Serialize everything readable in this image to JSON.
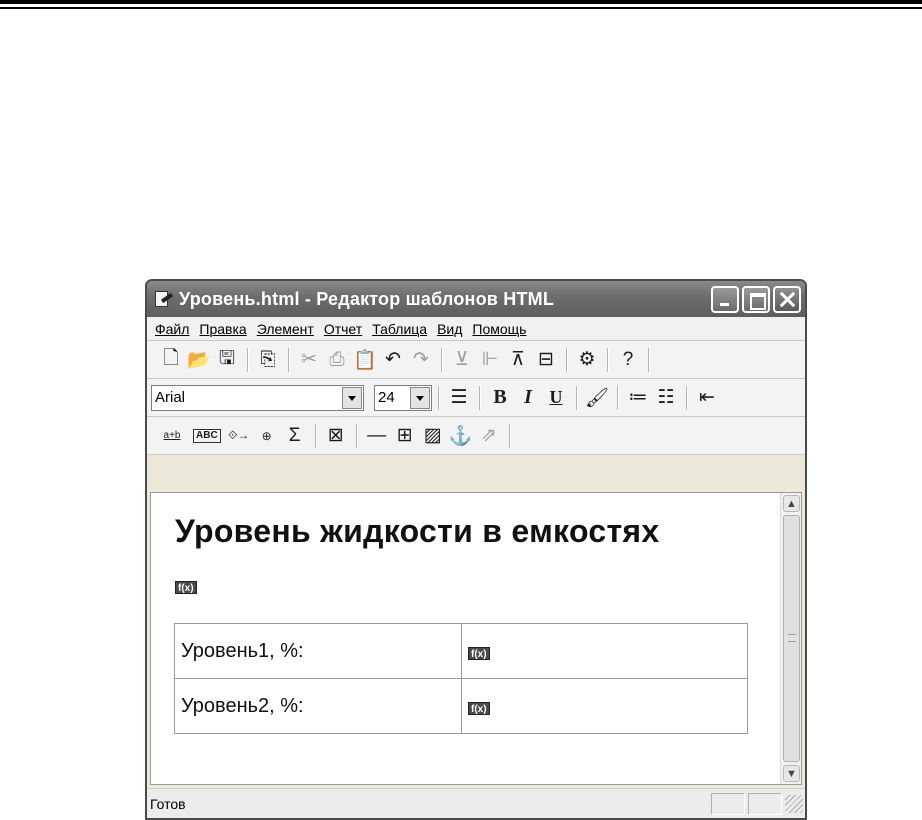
{
  "window": {
    "title": "Уровень.html - Редактор шаблонов HTML"
  },
  "menu": [
    "Файл",
    "Правка",
    "Элемент",
    "Отчет",
    "Таблица",
    "Вид",
    "Помощь"
  ],
  "format_toolbar": {
    "font_name": "Arial",
    "font_size": "24",
    "bold_label": "B",
    "italic_label": "I",
    "underline_label": "U"
  },
  "insert_toolbar": {
    "sum_label": "Σ",
    "abc_label": "ABC",
    "ab_label": "a+b"
  },
  "document": {
    "heading": "Уровень жидкости в емкостях",
    "function_marker": "f(x)",
    "table": [
      {
        "label": "Уровень1, %:",
        "value": "f(x)"
      },
      {
        "label": "Уровень2, %:",
        "value": "f(x)"
      }
    ]
  },
  "status": {
    "text": "Готов"
  }
}
